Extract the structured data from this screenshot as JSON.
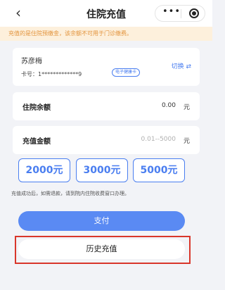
{
  "nav": {
    "back_icon": "chevron-left-icon",
    "back_glyph": "‹",
    "title": "住院充值",
    "more_glyph": "•••"
  },
  "notice": "充值的是住院预缴金，该余额不可用于门诊缴费。",
  "patient": {
    "name": "苏彦梅",
    "card_number": "卡号：1*************9",
    "card_type": "电子健康卡",
    "switch_label": "切换 ⇄"
  },
  "balance": {
    "label": "住院余额",
    "value": "0.00",
    "unit": "元"
  },
  "recharge": {
    "label": "充值金额",
    "placeholder": "0.01--5000",
    "unit": "元"
  },
  "amount_options": [
    "2000元",
    "3000元",
    "5000元"
  ],
  "hint": "充值成功后，如需退款，请到院内住院收费窗口办理。",
  "pay_label": "支付",
  "history_label": "历史充值",
  "colors": {
    "accent": "#4a7ef0",
    "notice_bg": "#fdf0dc",
    "notice_text": "#e2923a",
    "highlight": "#d9362b"
  }
}
